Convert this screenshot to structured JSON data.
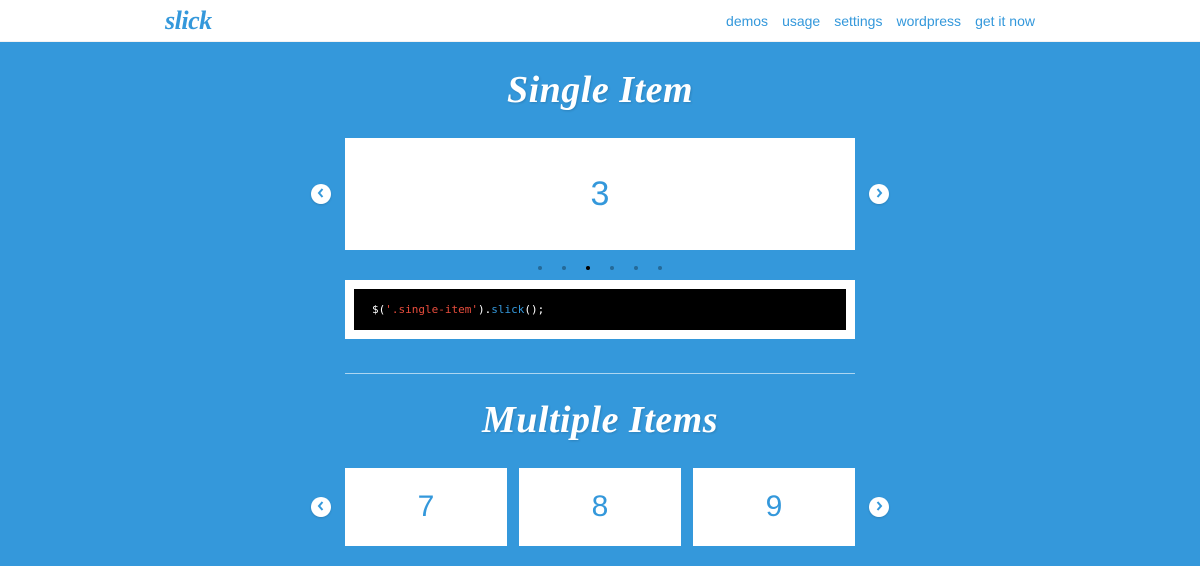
{
  "header": {
    "logo": "slick",
    "nav": {
      "demos": "demos",
      "usage": "usage",
      "settings": "settings",
      "wordpress": "wordpress",
      "getit": "get it now"
    }
  },
  "section1": {
    "title": "Single Item",
    "current_slide": "3",
    "code": {
      "fn": "$",
      "p1": "(",
      "str": "'.single-item'",
      "p2": ").",
      "method": "slick",
      "p3": "();"
    }
  },
  "section2": {
    "title": "Multiple Items",
    "slides": {
      "a": "7",
      "b": "8",
      "c": "9"
    }
  }
}
